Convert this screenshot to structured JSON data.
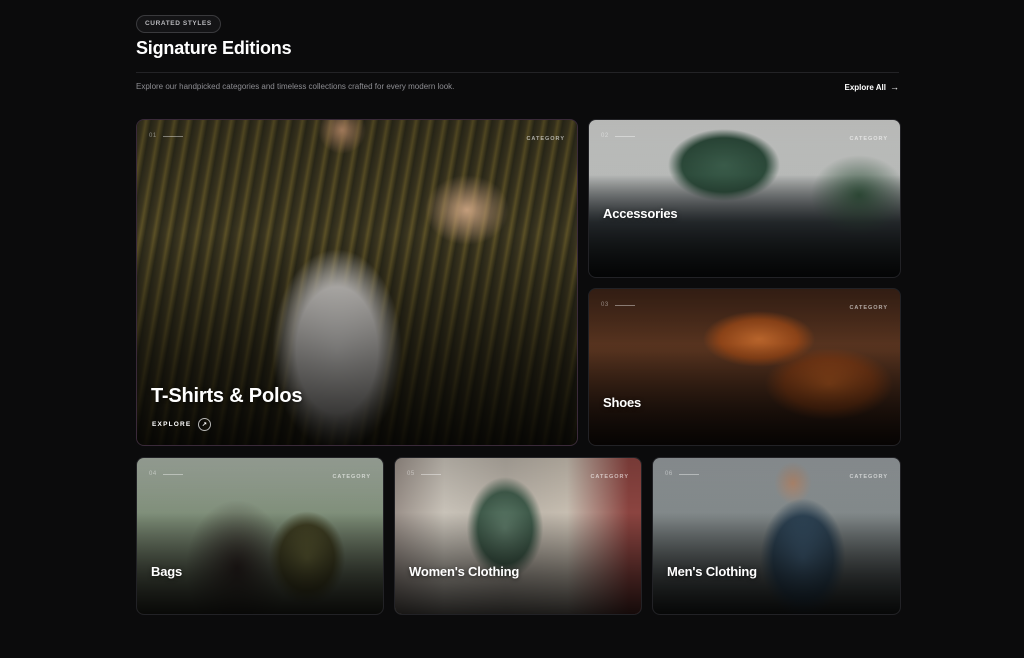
{
  "header": {
    "pill": "CURATED STYLES",
    "title": "Signature Editions",
    "subtitle": "Explore our handpicked categories and timeless collections crafted for every modern look.",
    "explore_all": "Explore All",
    "explore_all_icon": "arrow-right-icon"
  },
  "categories": [
    {
      "num": "01",
      "tag": "CATEGORY",
      "title": "T-Shirts & Polos",
      "cta": "EXPLORE"
    },
    {
      "num": "02",
      "tag": "CATEGORY",
      "title": "Accessories"
    },
    {
      "num": "03",
      "tag": "CATEGORY",
      "title": "Shoes"
    },
    {
      "num": "04",
      "tag": "CATEGORY",
      "title": "Bags"
    },
    {
      "num": "05",
      "tag": "CATEGORY",
      "title": "Women's Clothing"
    },
    {
      "num": "06",
      "tag": "CATEGORY",
      "title": "Men's Clothing"
    }
  ]
}
